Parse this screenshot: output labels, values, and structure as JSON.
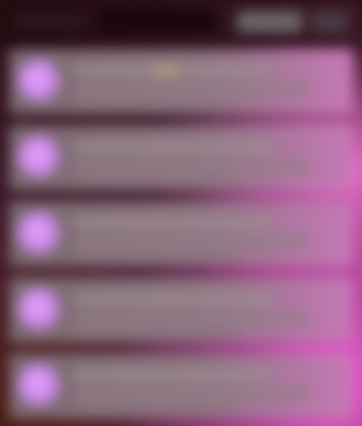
{
  "colors": {
    "accent": "#d56ad2",
    "avatar": "#d197f0",
    "header": "#1f0b0c"
  },
  "header": {
    "icon_left": "menu-icon",
    "icon_right": "more-icon"
  },
  "list": {
    "items": [
      {
        "avatar_icon": "user-avatar-icon"
      },
      {
        "avatar_icon": "user-avatar-icon"
      },
      {
        "avatar_icon": "user-avatar-icon"
      },
      {
        "avatar_icon": "user-avatar-icon"
      },
      {
        "avatar_icon": "user-avatar-icon"
      }
    ]
  }
}
